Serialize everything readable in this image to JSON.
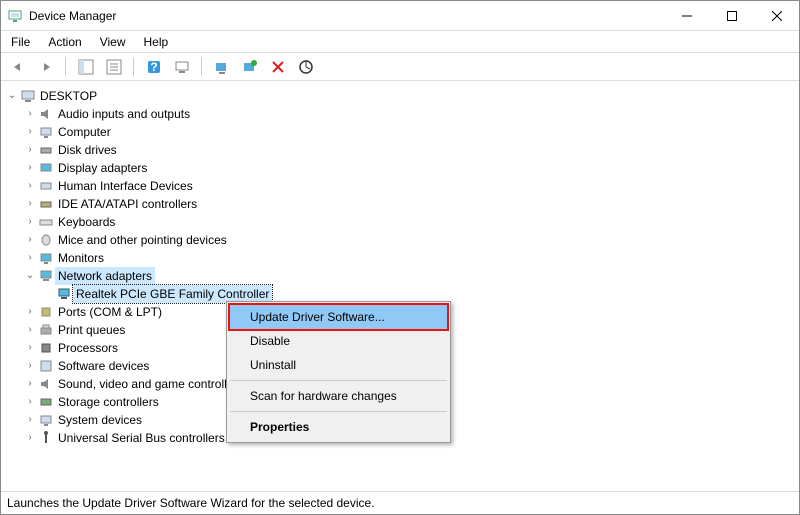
{
  "window": {
    "title": "Device Manager"
  },
  "menus": {
    "file": "File",
    "action": "Action",
    "view": "View",
    "help": "Help"
  },
  "root": {
    "label": "DESKTOP"
  },
  "categories": [
    {
      "label": "Audio inputs and outputs"
    },
    {
      "label": "Computer"
    },
    {
      "label": "Disk drives"
    },
    {
      "label": "Display adapters"
    },
    {
      "label": "Human Interface Devices"
    },
    {
      "label": "IDE ATA/ATAPI controllers"
    },
    {
      "label": "Keyboards"
    },
    {
      "label": "Mice and other pointing devices"
    },
    {
      "label": "Monitors"
    }
  ],
  "network": {
    "label": "Network adapters",
    "child": "Realtek PCIe GBE Family Controller"
  },
  "categories2": [
    {
      "label": "Ports (COM & LPT)"
    },
    {
      "label": "Print queues"
    },
    {
      "label": "Processors"
    },
    {
      "label": "Software devices"
    },
    {
      "label": "Sound, video and game controllers"
    },
    {
      "label": "Storage controllers"
    },
    {
      "label": "System devices"
    },
    {
      "label": "Universal Serial Bus controllers"
    }
  ],
  "context": {
    "update": "Update Driver Software...",
    "disable": "Disable",
    "uninstall": "Uninstall",
    "scan": "Scan for hardware changes",
    "properties": "Properties"
  },
  "status": "Launches the Update Driver Software Wizard for the selected device."
}
